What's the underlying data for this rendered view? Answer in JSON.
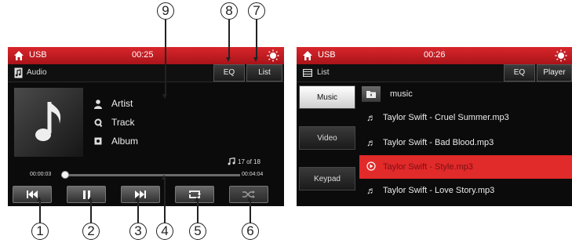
{
  "left": {
    "topbar": {
      "source": "USB",
      "time": "00:25"
    },
    "subbar": {
      "mode": "Audio",
      "eq": "EQ",
      "list": "List"
    },
    "meta": {
      "artist": "Artist",
      "track": "Track",
      "album": "Album"
    },
    "track_count": "17 of 18",
    "elapsed": "00:00:03",
    "total": "00:04:04",
    "progress_fraction": 0.02
  },
  "right": {
    "topbar": {
      "source": "USB",
      "time": "00:26"
    },
    "subbar": {
      "mode": "List",
      "eq": "EQ",
      "player": "Player"
    },
    "side": {
      "music": "Music",
      "video": "Video",
      "keypad": "Keypad"
    },
    "folder": "music",
    "files": [
      "Taylor Swift - Cruel Summer.mp3",
      "Taylor Swift - Bad Blood.mp3",
      "Taylor Swift - Style.mp3",
      "Taylor Swift - Love Story.mp3"
    ]
  },
  "callouts": {
    "c1": "1",
    "c2": "2",
    "c3": "3",
    "c4": "4",
    "c5": "5",
    "c6": "6",
    "c7": "7",
    "c8": "8",
    "c9": "9"
  },
  "colors": {
    "accent": "#d8262b",
    "selected_row": "#e12a2a"
  }
}
